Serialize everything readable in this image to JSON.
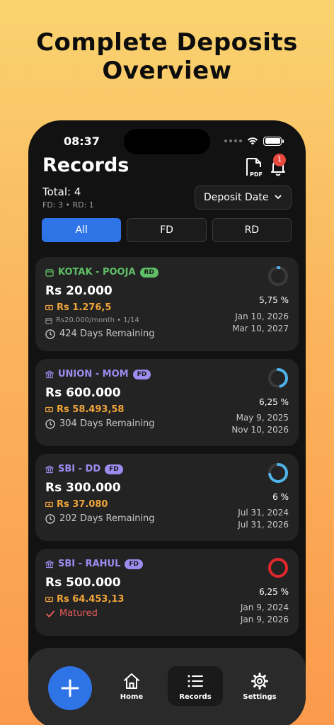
{
  "headline": {
    "line1": "Complete Deposits",
    "line2": "Overview"
  },
  "status_bar": {
    "time": "08:37"
  },
  "header": {
    "title": "Records",
    "pdf_icon": "pdf-file-icon",
    "bell_icon": "bell-icon",
    "notification_count": "1"
  },
  "summary": {
    "total": "Total: 4",
    "breakdown": "FD: 3 • RD: 1"
  },
  "sort": {
    "label": "Deposit Date"
  },
  "tabs": [
    {
      "label": "All",
      "active": true
    },
    {
      "label": "FD",
      "active": false
    },
    {
      "label": "RD",
      "active": false
    }
  ],
  "records": [
    {
      "bank": "KOTAK - POOJA",
      "type": "RD",
      "amount": "Rs 20.000",
      "interest": "Rs 1.276,5",
      "monthly": "Rs20.000/month • 1/14",
      "status": "424 Days Remaining",
      "rate": "5,75 %",
      "start_date": "Jan 10, 2026",
      "end_date": "Mar 10, 2027",
      "progress": 0.02,
      "accent": "#5fbf66"
    },
    {
      "bank": "UNION - MOM",
      "type": "FD",
      "amount": "Rs 600.000",
      "interest": "Rs 58.493,58",
      "status": "304 Days Remaining",
      "rate": "6,25 %",
      "start_date": "May 9, 2025",
      "end_date": "Nov 10, 2026",
      "progress": 0.45,
      "accent": "#9c8cf0"
    },
    {
      "bank": "SBI - DD",
      "type": "FD",
      "amount": "Rs 300.000",
      "interest": "Rs 37.080",
      "status": "202 Days Remaining",
      "rate": "6 %",
      "start_date": "Jul 31, 2024",
      "end_date": "Jul 31, 2026",
      "progress": 0.72,
      "accent": "#9c8cf0"
    },
    {
      "bank": "SBI - RAHUL",
      "type": "FD",
      "amount": "Rs 500.000",
      "interest": "Rs 64.453,13",
      "status": "Matured",
      "rate": "6,25 %",
      "start_date": "Jan 9, 2024",
      "end_date": "Jan 9, 2026",
      "progress": 1.0,
      "accent": "#9c8cf0"
    }
  ],
  "colors": {
    "primary": "#2f74e6",
    "ring_active": "#4fb3ea",
    "ring_matured": "#e0272b",
    "interest": "#f0a53a",
    "matured": "#e85c5c"
  },
  "nav": {
    "fab_icon": "plus-icon",
    "items": [
      {
        "label": "Home",
        "icon": "home-icon",
        "active": false
      },
      {
        "label": "Records",
        "icon": "list-icon",
        "active": true
      },
      {
        "label": "Settings",
        "icon": "gear-icon",
        "active": false
      }
    ]
  }
}
